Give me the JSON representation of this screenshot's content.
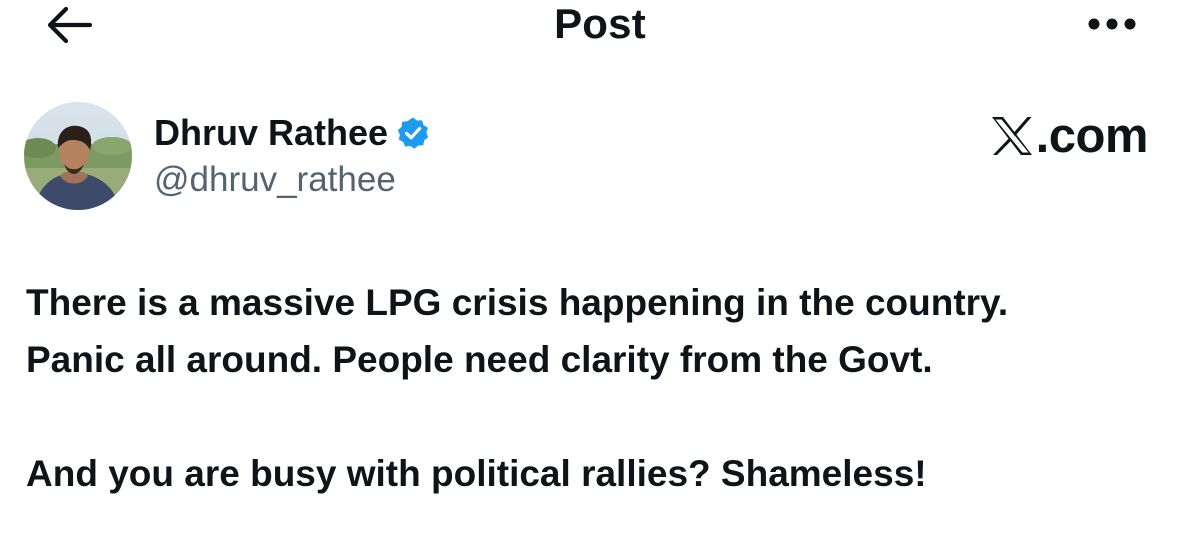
{
  "header": {
    "title": "Post",
    "back_icon": "arrow-left-icon",
    "more_icon": "more-horizontal-icon"
  },
  "author": {
    "display_name": "Dhruv Rathee",
    "handle": "@dhruv_rathee",
    "verified": true,
    "verified_badge_icon": "verified-badge-icon",
    "verified_color": "#1d9bf0"
  },
  "brand": {
    "logo_icon": "x-logo-icon",
    "text": ".com"
  },
  "post": {
    "line1": "There is a massive LPG crisis happening in the country.",
    "line2": "Panic all around. People need clarity from the Govt.",
    "line3": "And you are busy with political rallies? Shameless!"
  },
  "colors": {
    "text_primary": "#0f1419",
    "text_secondary": "#536471",
    "background": "#ffffff"
  }
}
